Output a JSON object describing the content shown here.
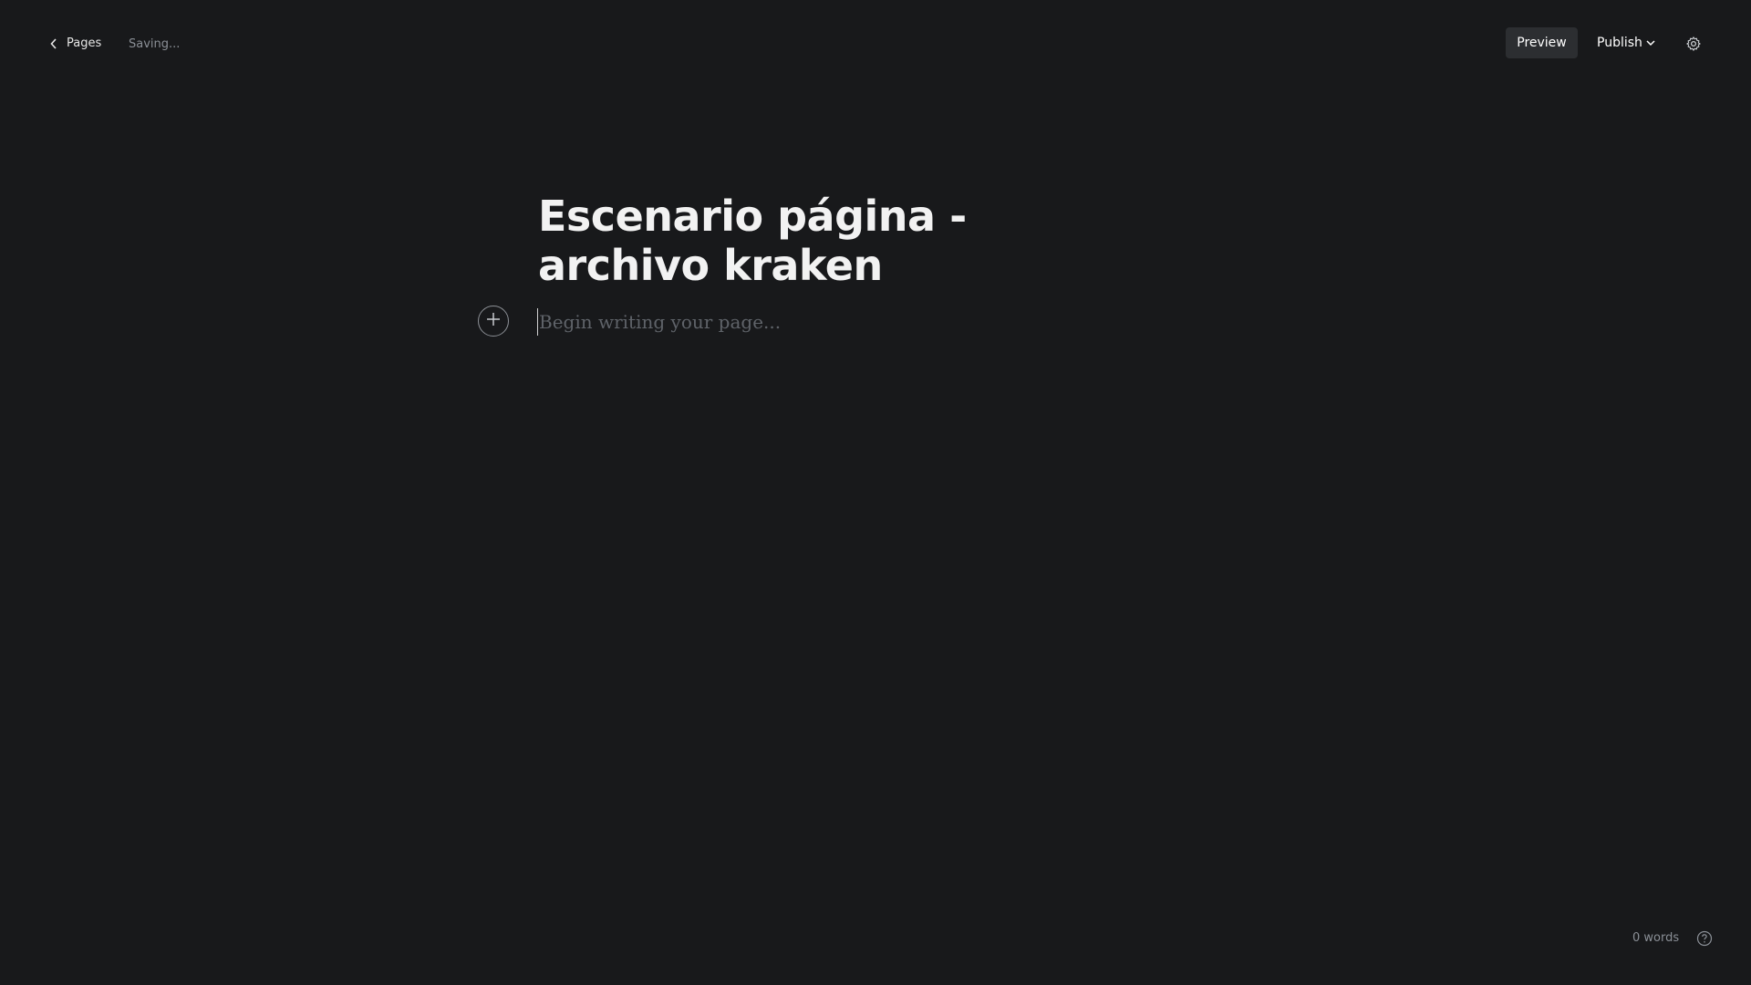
{
  "topbar": {
    "back_label": "Pages",
    "status_text": "Saving...",
    "preview_label": "Preview",
    "publish_label": "Publish"
  },
  "editor": {
    "title": "Escenario página - archivo kraken",
    "body_placeholder": "Begin writing your page..."
  },
  "footer": {
    "word_count": "0 words"
  },
  "icons": {
    "back": "chevron-left-icon",
    "publish_dropdown": "chevron-down-icon",
    "settings": "gear-icon",
    "add_card": "plus-icon",
    "help": "question-circle-icon"
  },
  "colors": {
    "background": "#18191b",
    "preview_button_bg": "#2c2e31",
    "muted_text": "#8a8f96",
    "placeholder_text": "#5f6369"
  }
}
